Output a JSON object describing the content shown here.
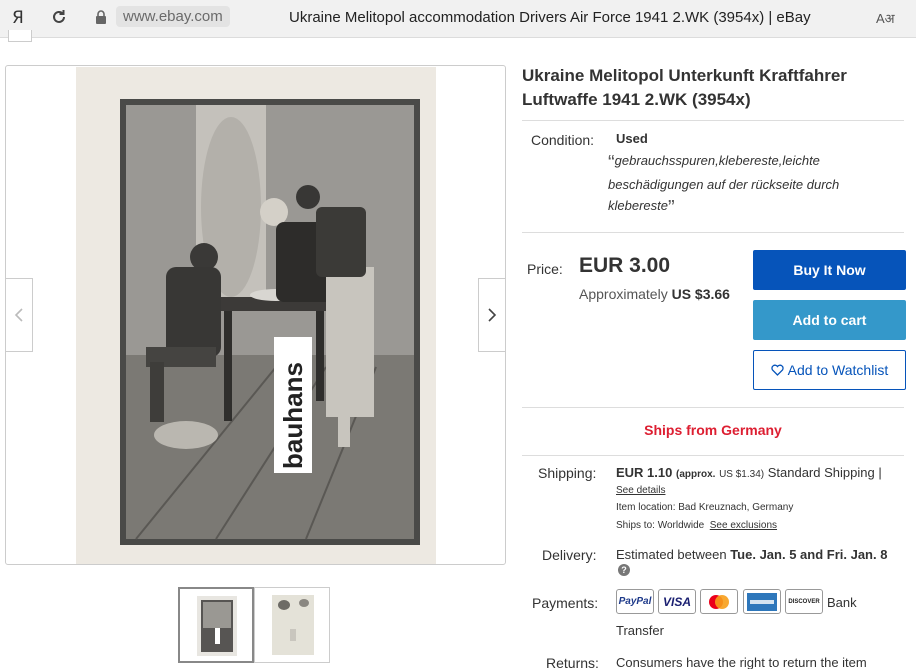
{
  "browser": {
    "logo": "Я",
    "url": "www.ebay.com",
    "page_title": "Ukraine Melitopol accommodation Drivers Air Force 1941 2.WK (3954x) | eBay",
    "translate_glyph": "Aअ"
  },
  "gallery": {
    "watermark": "bauhans",
    "thumbnails": [
      "front",
      "back"
    ]
  },
  "listing": {
    "title": "Ukraine Melitopol Unterkunft Kraftfahrer Luftwaffe 1941 2.WK (3954x)",
    "condition_label": "Condition:",
    "condition_value": "Used",
    "condition_note": "gebrauchsspuren,klebereste,leichte beschädigungen auf der rückseite durch klebereste",
    "price_label": "Price:",
    "price": "EUR 3.00",
    "approx_prefix": "Approximately",
    "approx_value": "US $3.66",
    "buy_now": "Buy It Now",
    "add_to_cart": "Add to cart",
    "add_to_watchlist": "Add to Watchlist",
    "ships_from": "Ships from Germany",
    "shipping_label": "Shipping:",
    "shipping_cost": "EUR 1.10",
    "shipping_approx": "(approx.",
    "shipping_approx_value": "US $1.34)",
    "shipping_service": "Standard Shipping |",
    "see_details": "See details",
    "item_location_label": "Item location:",
    "item_location": "Bad Kreuznach, Germany",
    "ships_to_label": "Ships to:",
    "ships_to": "Worldwide",
    "see_exclusions": "See exclusions",
    "delivery_label": "Delivery:",
    "delivery_prefix": "Estimated between",
    "delivery_dates": "Tue. Jan. 5 and Fri. Jan. 8",
    "payments_label": "Payments:",
    "payment_methods": [
      "PayPal",
      "VISA",
      "Mastercard",
      "American Express",
      "DISCOVER"
    ],
    "bank_transfer_1": "Bank",
    "bank_transfer_2": "Transfer",
    "returns_label": "Returns:",
    "returns_text": "Consumers have the right to return the item"
  },
  "colors": {
    "buy_now": "#0654ba",
    "add_to_cart": "#3498ca",
    "ships_from": "#dd1e31"
  }
}
